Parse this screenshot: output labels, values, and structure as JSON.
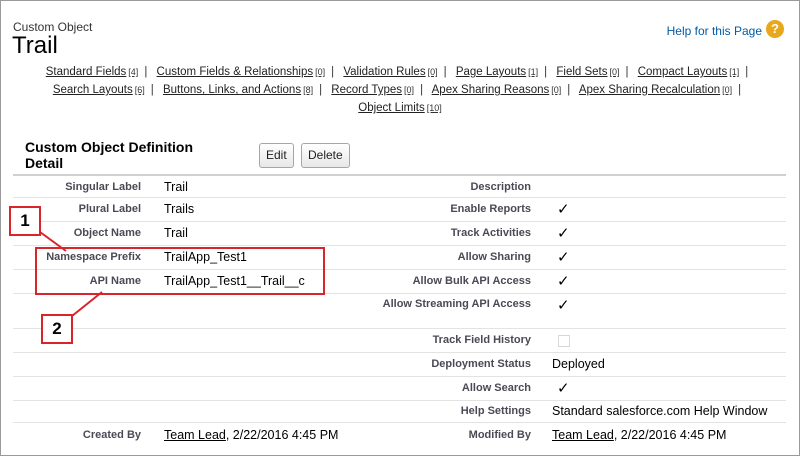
{
  "header": {
    "object_type": "Custom Object",
    "object_name": "Trail",
    "help_link": "Help for this Page",
    "help_icon": "question-icon"
  },
  "related_links": {
    "row1": [
      {
        "label": "Standard Fields",
        "count": "[4]"
      },
      {
        "label": "Custom Fields & Relationships",
        "count": "[0]"
      },
      {
        "label": "Validation Rules",
        "count": "[0]"
      },
      {
        "label": "Page Layouts",
        "count": "[1]"
      },
      {
        "label": "Field Sets",
        "count": "[0]"
      },
      {
        "label": "Compact Layouts",
        "count": "[1]"
      }
    ],
    "row2": [
      {
        "label": "Search Layouts",
        "count": "[6]"
      },
      {
        "label": "Buttons, Links, and Actions",
        "count": "[8]"
      },
      {
        "label": "Record Types",
        "count": "[0]"
      },
      {
        "label": "Apex Sharing Reasons",
        "count": "[0]"
      },
      {
        "label": "Apex Sharing Recalculation",
        "count": "[0]"
      }
    ],
    "row3": [
      {
        "label": "Object Limits",
        "count": "[10]"
      }
    ]
  },
  "detail": {
    "title": "Custom Object Definition Detail",
    "edit_label": "Edit",
    "delete_label": "Delete",
    "left": {
      "singular_label": {
        "label": "Singular Label",
        "value": "Trail"
      },
      "plural_label": {
        "label": "Plural Label",
        "value": "Trails"
      },
      "object_name": {
        "label": "Object Name",
        "value": "Trail"
      },
      "namespace_prefix": {
        "label": "Namespace Prefix",
        "value": "TrailApp_Test1"
      },
      "api_name": {
        "label": "API Name",
        "value": "TrailApp_Test1__Trail__c"
      },
      "created_by": {
        "label": "Created By",
        "user": "Team Lead",
        "date": ", 2/22/2016 4:45 PM"
      }
    },
    "right": {
      "description": {
        "label": "Description"
      },
      "enable_reports": {
        "label": "Enable Reports",
        "checked": true
      },
      "track_activities": {
        "label": "Track Activities",
        "checked": true
      },
      "allow_sharing": {
        "label": "Allow Sharing",
        "checked": true
      },
      "allow_bulk_api": {
        "label": "Allow Bulk API Access",
        "checked": true
      },
      "allow_streaming_api": {
        "label": "Allow Streaming API Access",
        "checked": true
      },
      "track_field_history": {
        "label": "Track Field History",
        "checked": false
      },
      "deployment_status": {
        "label": "Deployment Status",
        "value": "Deployed"
      },
      "allow_search": {
        "label": "Allow Search",
        "checked": true
      },
      "help_settings": {
        "label": "Help Settings",
        "value": "Standard salesforce.com Help Window"
      },
      "modified_by": {
        "label": "Modified By",
        "user": "Team Lead",
        "date": ", 2/22/2016 4:45 PM"
      }
    },
    "check_glyph": "✓"
  },
  "callouts": {
    "one": "1",
    "two": "2",
    "color": "#d8242a"
  }
}
